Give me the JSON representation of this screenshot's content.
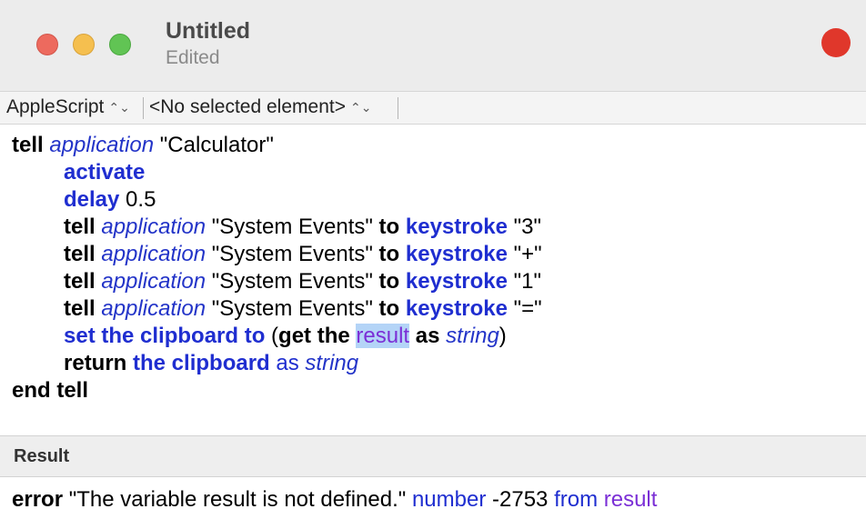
{
  "window": {
    "title": "Untitled",
    "subtitle": "Edited"
  },
  "navbar": {
    "language": "AppleScript",
    "element": "<No selected element>",
    "chevron": "⌃⌄"
  },
  "code": {
    "line1": {
      "tell": "tell",
      "application": "application",
      "name": "\"Calculator\""
    },
    "line2": {
      "activate": "activate"
    },
    "line3": {
      "delay": "delay",
      "value": "0.5"
    },
    "line4": {
      "tell": "tell",
      "application": "application",
      "target": "\"System Events\"",
      "to": "to",
      "keystroke": "keystroke",
      "key": "\"3\""
    },
    "line5": {
      "tell": "tell",
      "application": "application",
      "target": "\"System Events\"",
      "to": "to",
      "keystroke": "keystroke",
      "key": "\"+\""
    },
    "line6": {
      "tell": "tell",
      "application": "application",
      "target": "\"System Events\"",
      "to": "to",
      "keystroke": "keystroke",
      "key": "\"1\""
    },
    "line7": {
      "tell": "tell",
      "application": "application",
      "target": "\"System Events\"",
      "to": "to",
      "keystroke": "keystroke",
      "key": "\"=\""
    },
    "line8": {
      "set": "set the clipboard to",
      "open": " (",
      "get": "get the",
      "result": "result",
      "as": "as",
      "string": "string",
      "close": ")"
    },
    "line9": {
      "return": "return",
      "clipboard": "the clipboard",
      "as": "as",
      "string": "string"
    },
    "line10": {
      "end": "end tell"
    }
  },
  "result": {
    "header": "Result",
    "error_kw": "error",
    "message": "\"The variable result is not defined.\"",
    "number_kw": "number",
    "code": "-2753",
    "from_kw": "from",
    "from_val": "result"
  }
}
